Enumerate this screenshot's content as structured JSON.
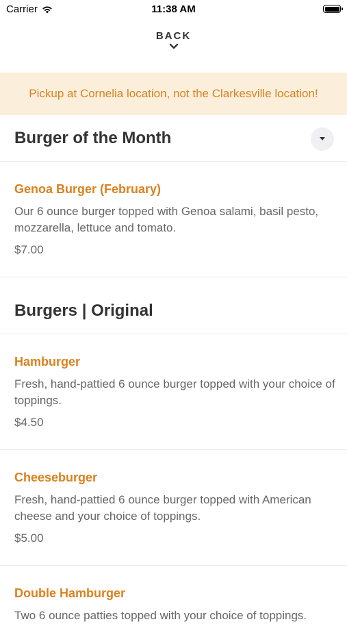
{
  "status": {
    "carrier": "Carrier",
    "time": "11:38 AM"
  },
  "nav": {
    "back_label": "BACK"
  },
  "notice": {
    "text": "Pickup at Cornelia location, not the Clarkesville location!"
  },
  "sections": [
    {
      "title": "Burger of the Month",
      "items": [
        {
          "name": "Genoa Burger (February)",
          "description": "Our 6 ounce burger topped with Genoa salami, basil pesto, mozzarella, lettuce and tomato.",
          "price": "$7.00"
        }
      ]
    },
    {
      "title": "Burgers | Original",
      "items": [
        {
          "name": "Hamburger",
          "description": "Fresh, hand-pattied 6 ounce burger topped with your choice of toppings.",
          "price": "$4.50"
        },
        {
          "name": "Cheeseburger",
          "description": "Fresh, hand-pattied 6 ounce burger topped with American cheese and your choice of toppings.",
          "price": "$5.00"
        },
        {
          "name": "Double Hamburger",
          "description": "Two 6 ounce patties topped with your choice of toppings.",
          "price": ""
        }
      ]
    }
  ],
  "colors": {
    "accent": "#d9821f",
    "notice_bg": "#fbefdc"
  },
  "icons": {
    "wifi": "wifi-icon",
    "battery": "battery-icon",
    "back": "chevron-down-icon",
    "collapse": "caret-down-icon"
  }
}
